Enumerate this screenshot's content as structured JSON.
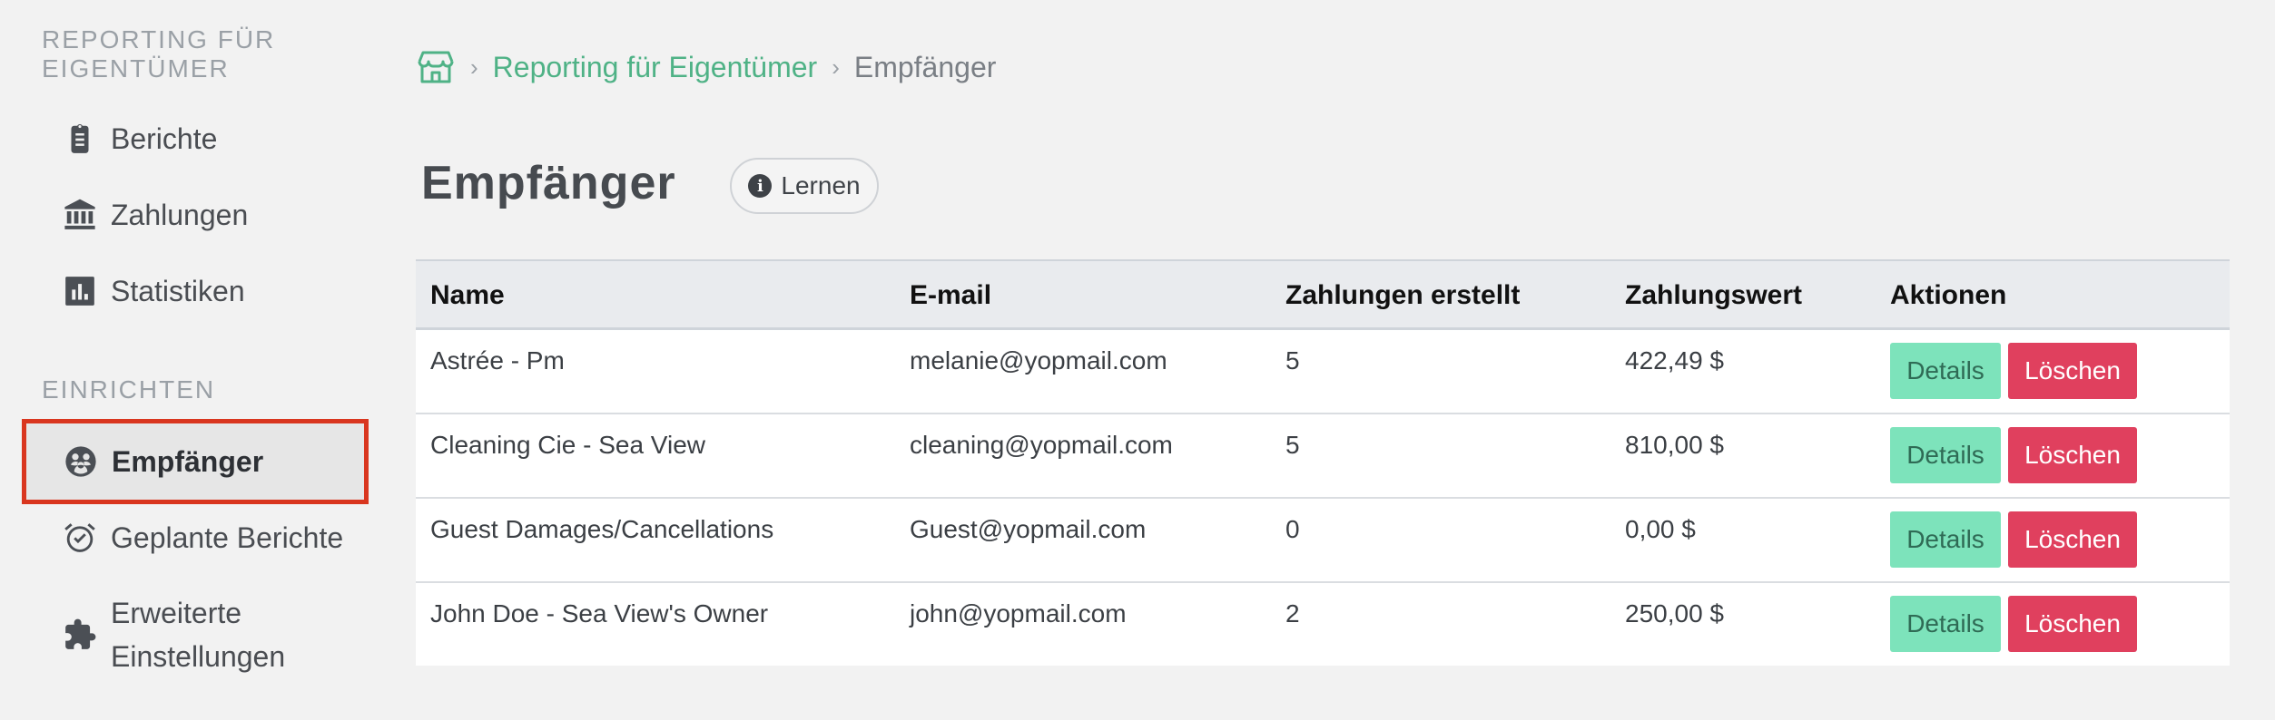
{
  "sidebar": {
    "section_reporting": "REPORTING FÜR EIGENTÜMER",
    "section_setup": "EINRICHTEN",
    "items": [
      {
        "label": "Berichte",
        "icon": "clipboard-icon"
      },
      {
        "label": "Zahlungen",
        "icon": "bank-icon"
      },
      {
        "label": "Statistiken",
        "icon": "bar-chart-icon"
      },
      {
        "label": "Empfänger",
        "icon": "recipients-icon",
        "active": true
      },
      {
        "label": "Geplante Berichte",
        "icon": "alarm-clock-icon"
      },
      {
        "label": "Erweiterte Einstellungen",
        "icon": "puzzle-icon"
      }
    ]
  },
  "breadcrumb": {
    "home_icon": "store-icon",
    "parent": "Reporting für Eigentümer",
    "current": "Empfänger"
  },
  "page": {
    "title": "Empfänger",
    "learn_label": "Lernen"
  },
  "table": {
    "headers": [
      "Name",
      "E-mail",
      "Zahlungen erstellt",
      "Zahlungswert",
      "Aktionen"
    ],
    "rows": [
      {
        "name": "Astrée - Pm",
        "email": "melanie@yopmail.com",
        "count": "5",
        "value": "422,49 $"
      },
      {
        "name": "Cleaning Cie - Sea View",
        "email": "cleaning@yopmail.com",
        "count": "5",
        "value": "810,00 $"
      },
      {
        "name": "Guest Damages/Cancellations",
        "email": "Guest@yopmail.com",
        "count": "0",
        "value": "0,00 $"
      },
      {
        "name": "John Doe - Sea View's Owner",
        "email": "john@yopmail.com",
        "count": "2",
        "value": "250,00 $"
      }
    ],
    "details_label": "Details",
    "delete_label": "Löschen"
  },
  "colors": {
    "accent_green": "#4fb286",
    "details_button": "#7de3bb",
    "delete_button": "#e0405e",
    "highlight_border": "#d9361f"
  }
}
